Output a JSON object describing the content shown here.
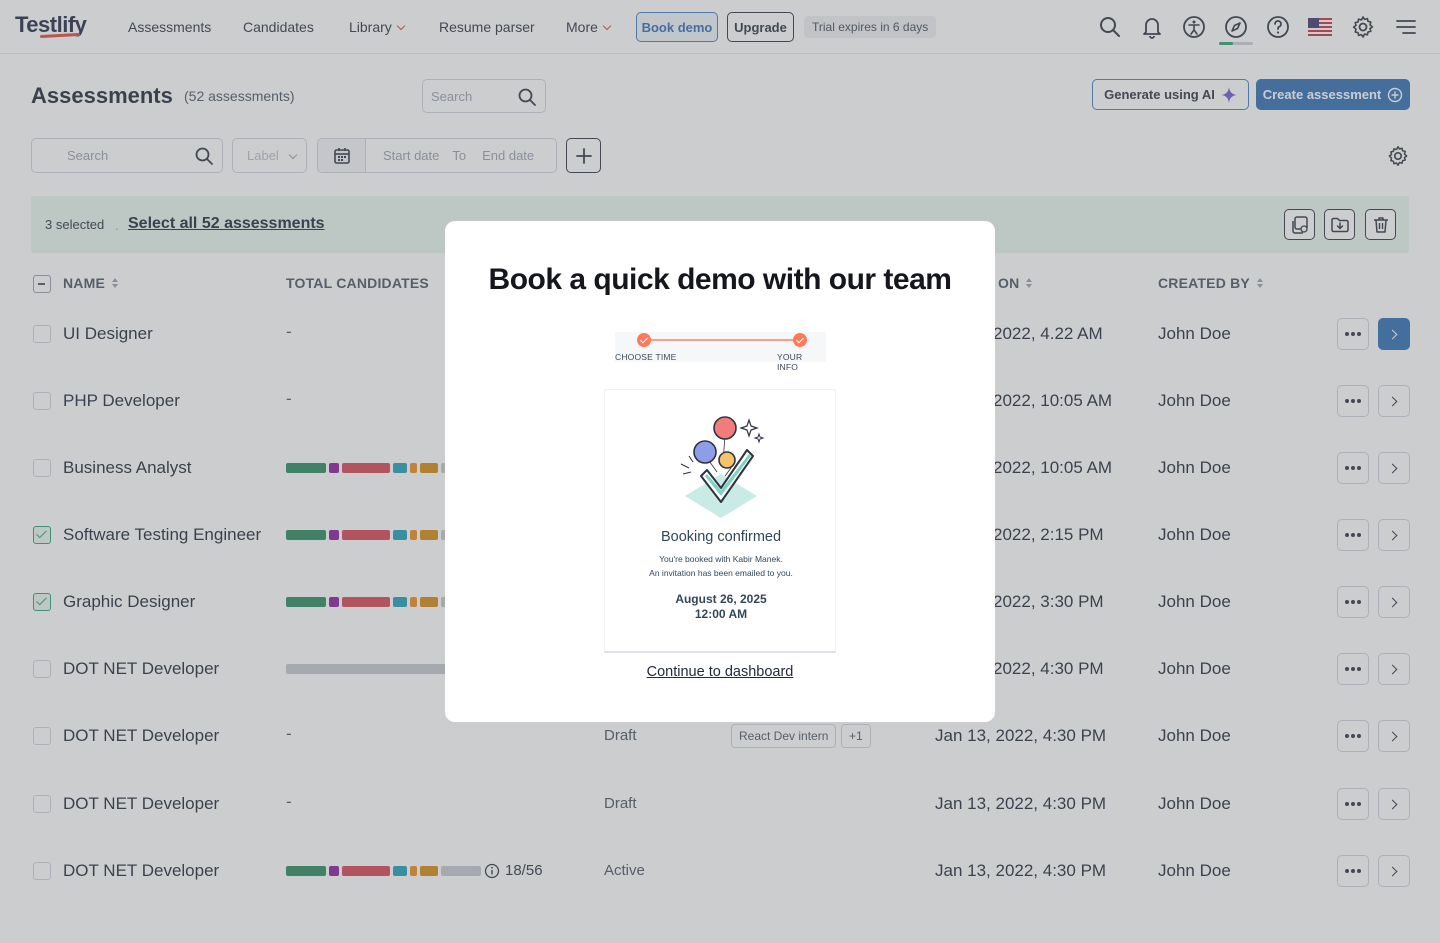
{
  "nav": {
    "logo": "Testlify",
    "links": [
      "Assessments",
      "Candidates",
      "Library",
      "Resume parser",
      "More"
    ],
    "book_demo": "Book demo",
    "upgrade": "Upgrade",
    "trial": "Trial expires in 6 days"
  },
  "header": {
    "title": "Assessments",
    "count": "(52 assessments)",
    "search_placeholder": "Search",
    "generate_ai": "Generate using AI",
    "create": "Create assessment"
  },
  "filters": {
    "search_placeholder": "Search",
    "label_placeholder": "Label",
    "start_date": "Start date",
    "to": "To",
    "end_date": "End date"
  },
  "selection": {
    "count": "3 selected",
    "dot": ".",
    "select_all": "Select all 52 assessments"
  },
  "table": {
    "headers": {
      "name": "NAME",
      "total_candidates": "TOTAL CANDIDATES",
      "created_on_partial": "ON",
      "created_by": "CREATED BY"
    },
    "rows": [
      {
        "checked": false,
        "name": "UI Designer",
        "candidates": "-",
        "status": "",
        "date": "2022, 4.22 AM",
        "by": "John Doe",
        "primary": true
      },
      {
        "checked": false,
        "name": "PHP Developer",
        "candidates": "-",
        "status": "",
        "date": "2022, 10:05 AM",
        "by": "John Doe",
        "primary": false
      },
      {
        "checked": false,
        "name": "Business Analyst",
        "candidates": "bars",
        "status": "",
        "date": "2022, 10:05 AM",
        "by": "John Doe",
        "primary": false
      },
      {
        "checked": true,
        "name": "Software Testing Engineer",
        "candidates": "bars",
        "status": "",
        "date": "2022, 2:15 PM",
        "by": "John Doe",
        "primary": false
      },
      {
        "checked": true,
        "name": "Graphic Designer",
        "candidates": "bars",
        "status": "",
        "date": "2022, 3:30 PM",
        "by": "John Doe",
        "primary": false
      },
      {
        "checked": false,
        "name": "DOT NET Developer",
        "candidates": "grey",
        "status": "",
        "date": "2022, 4:30 PM",
        "by": "John Doe",
        "primary": false
      },
      {
        "checked": false,
        "name": "DOT NET Developer",
        "candidates": "-",
        "status": "Draft",
        "date": "Jan 13, 2022, 4:30 PM",
        "by": "John Doe",
        "primary": false,
        "tag": "React Dev intern",
        "tag_more": "+1"
      },
      {
        "checked": false,
        "name": "DOT NET Developer",
        "candidates": "-",
        "status": "Draft",
        "date": "Jan 13, 2022, 4:30 PM",
        "by": "John Doe",
        "primary": false
      },
      {
        "checked": false,
        "name": "DOT NET Developer",
        "candidates": "bars",
        "status": "Active",
        "date": "Jan 13, 2022, 4:30 PM",
        "by": "John Doe",
        "primary": false,
        "count": "18/56"
      }
    ]
  },
  "modal": {
    "title": "Book a quick demo with our team",
    "step1": "CHOOSE TIME",
    "step2": "YOUR INFO",
    "confirmed": "Booking confirmed",
    "booked_with": "You're booked with Kabir Manek.",
    "invitation": "An invitation has been emailed to you.",
    "date": "August 26, 2025",
    "time": "12:00 AM",
    "continue": "Continue to dashboard"
  },
  "colors": {
    "brand_blue": "#2f6db0",
    "accent_red": "#e0483c",
    "success_green": "#2aa373",
    "hubspot_orange": "#ff7a59"
  }
}
